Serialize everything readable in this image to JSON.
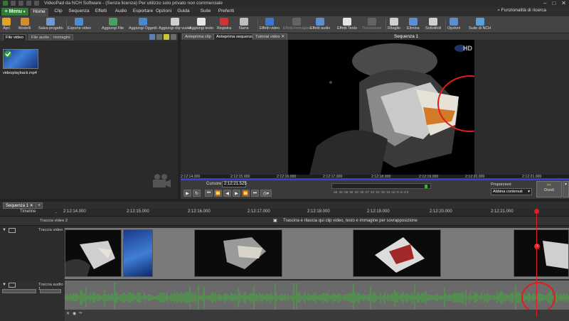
{
  "window": {
    "title": "VideoPad da NCH Software - (Senza licenza) Per utilizzo solo privato non commerciale",
    "help_search": "Funzionalità di ricerca"
  },
  "menu": {
    "button_label": "Menu",
    "tabs": [
      "Home",
      "Clip",
      "Sequenza",
      "Effetti",
      "Audio",
      "Esportare",
      "Opzioni",
      "Guida",
      "Suite",
      "Preferiti"
    ]
  },
  "toolbar": {
    "items": [
      {
        "label": "Apri",
        "icon": "folder-open-icon",
        "color": "#e0a526"
      },
      {
        "label": "Modelli",
        "icon": "templates-icon",
        "color": "#d88a2c"
      },
      {
        "label": "Salva progetto",
        "icon": "save-icon",
        "color": "#6f9ad6"
      },
      {
        "label": "Esporta video",
        "icon": "export-video-icon",
        "color": "#4d8ad8"
      },
      {
        "label": "Aggiungi File",
        "icon": "add-file-icon",
        "color": "#4aa05a"
      },
      {
        "label": "Aggiungi Oggetti",
        "icon": "add-objects-icon",
        "color": "#4a86c8"
      },
      {
        "label": "Aggiungi clip vuota",
        "icon": "add-blank-clip-icon",
        "color": "#cfcfcf"
      },
      {
        "label": "Aggiungi testo",
        "icon": "add-text-icon",
        "color": "#e6e6e6"
      },
      {
        "label": "Registra",
        "icon": "record-icon",
        "color": "#d23232"
      },
      {
        "label": "Narra",
        "icon": "narrate-mic-icon",
        "color": "#bfbfbf"
      },
      {
        "label": "Effetti video",
        "icon": "video-effects-icon",
        "color": "#3c78d0"
      },
      {
        "label": "Effetti immagine",
        "icon": "image-effects-icon",
        "color": "#8a8a8a"
      },
      {
        "label": "Effetti audio",
        "icon": "audio-effects-icon",
        "color": "#5a8fd4"
      },
      {
        "label": "Effetti Testo",
        "icon": "text-effects-icon",
        "color": "#e6e6e6"
      },
      {
        "label": "Transizione",
        "icon": "transition-icon",
        "color": "#8a8a8a"
      },
      {
        "label": "Ritaglio",
        "icon": "crop-icon",
        "color": "#cfcfcf"
      },
      {
        "label": "Elimina",
        "icon": "delete-icon",
        "color": "#5a8fd4"
      },
      {
        "label": "Sottotitoli",
        "icon": "subtitles-icon",
        "color": "#d0d0d0"
      },
      {
        "label": "Opzioni",
        "icon": "options-icon",
        "color": "#5a8fd4"
      },
      {
        "label": "Suite di NCH",
        "icon": "nch-suite-icon",
        "color": "#5aa0d8"
      }
    ]
  },
  "left_panel": {
    "tabs": [
      "File video",
      "File audio",
      "Immagini"
    ],
    "media": [
      {
        "name": "videoplayback.mp4"
      }
    ]
  },
  "preview": {
    "tabs": [
      "Anteprima clip",
      "Anteprima sequenza",
      "Tutorial video"
    ],
    "title": "Sequenza 1",
    "watermark": "HD",
    "ruler": [
      "2:12:14.000",
      "2:12:15.000",
      "2:12:16.000",
      "2:12:17.000",
      "2:12:18.000",
      "2:12:19.000",
      "2:12:20.000",
      "2:12:21.000"
    ],
    "cursor_label": "Cursore:",
    "cursor_value": "2:12:21.525",
    "meter_ticks": "-45 -42 -39 -36 -33 -30 -27 -24 -21 -18 -15 -12 -9 -6 -3 0",
    "proportions_label": "Proporzioni:",
    "proportions_value": "Abbina contenuti",
    "split_label": "Dividi"
  },
  "sequence": {
    "tab": "Sequenza 1",
    "timeline_label": "Timeline",
    "ruler": [
      "2:12:14.000",
      "2:12:15.000",
      "2:12:16.000",
      "2:12:17.000",
      "2:12:18.000",
      "2:12:19.000",
      "2:12:20.000",
      "2:12:21.000"
    ],
    "video_track_2": "Traccia video 2",
    "overlay_hint": "Trascina e rilascia qui clip video, testo e immagine per sovrapposizione",
    "video_track_1": "Traccia video 1",
    "audio_track_1": "Traccia audio 1"
  },
  "colors": {
    "accent_green": "#2e7d32",
    "playhead": "#e41e1e",
    "waveform": "#3fae3a",
    "ruler_bar": "#3b3bd8"
  }
}
